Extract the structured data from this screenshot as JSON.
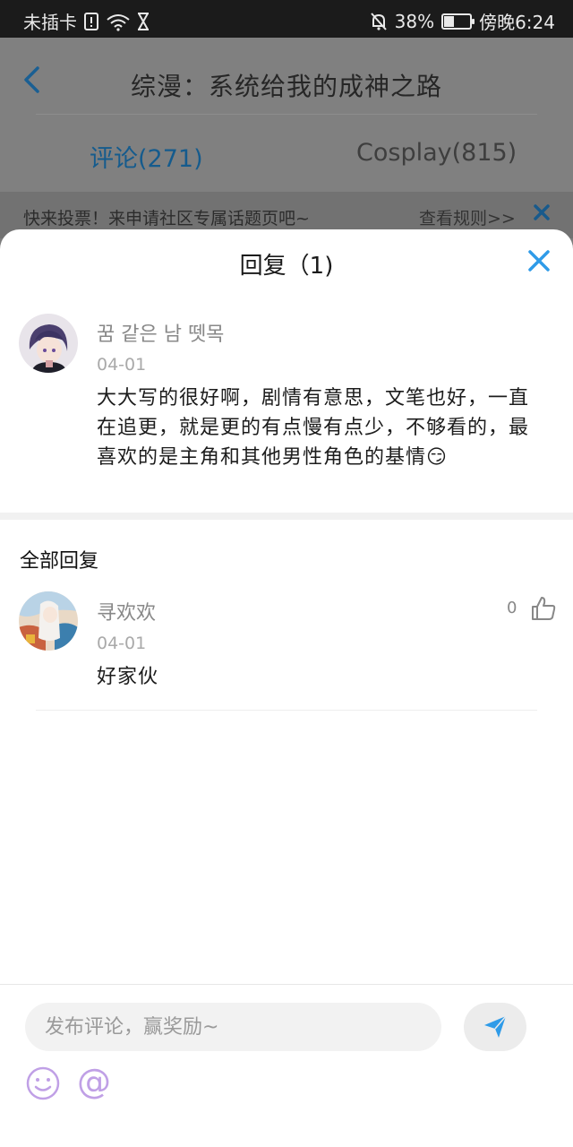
{
  "status_bar": {
    "carrier": "未插卡",
    "battery": "38%",
    "battery_level": 0.38,
    "time": "傍晚6:24"
  },
  "background_page": {
    "title": "综漫：系统给我的成神之路",
    "tabs": [
      {
        "label": "评论(271)",
        "active": true
      },
      {
        "label": "Cosplay(815)",
        "active": false
      }
    ],
    "notice": {
      "text": "快来投票！来申请社区专属话题页吧~",
      "link": "查看规则>>"
    }
  },
  "sheet": {
    "title": "回复（1)",
    "original_comment": {
      "username": "꿈 같은 남 뗏목",
      "date": "04-01",
      "text": "大大写的很好啊，剧情有意思，文笔也好，一直在追更，就是更的有点慢有点少，不够看的，最喜欢的是主角和其他男性角色的基情😏"
    },
    "all_replies_label": "全部回复",
    "replies": [
      {
        "username": "寻欢欢",
        "date": "04-01",
        "text": "好家伙",
        "likes": "0"
      }
    ]
  },
  "input_bar": {
    "placeholder": "发布评论，赢奖励~",
    "at_symbol": "@"
  },
  "colors": {
    "accent": "#2f9be8",
    "emoji_accent": "#c0a0e6"
  }
}
